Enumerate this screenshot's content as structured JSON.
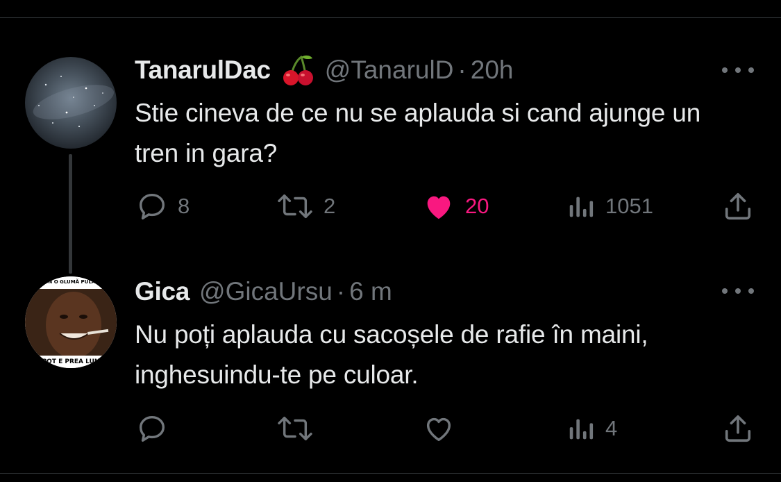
{
  "tweets": [
    {
      "display_name": "TanarulDac",
      "name_emoji": "cherries",
      "handle": "@TanarulD",
      "separator": "·",
      "time": "20h",
      "text": "Stie cineva de ce nu se aplauda si cand ajunge un tren in gara?",
      "avatar": "starry-night-sky-avatar",
      "actions": {
        "reply": {
          "icon": "reply-icon",
          "count": "8"
        },
        "retweet": {
          "icon": "retweet-icon",
          "count": "2"
        },
        "like": {
          "icon": "heart-filled-icon",
          "count": "20",
          "liked": true,
          "color": "#f91880"
        },
        "views": {
          "icon": "views-icon",
          "count": "1051"
        },
        "share": {
          "icon": "share-icon"
        }
      }
    },
    {
      "display_name": "Gica",
      "handle": "@GicaUrsu",
      "separator": "·",
      "time": "6 m",
      "text": "Nu poți aplauda cu sacoșele de rafie în maini, inghesuindu-te pe culoar.",
      "avatar": "meme-man-avatar",
      "avatar_caption_top": "VI SPUN O GLUMĂ PULA MEA?",
      "avatar_caption_bottom": "POT E PREA LUN",
      "actions": {
        "reply": {
          "icon": "reply-icon",
          "count": ""
        },
        "retweet": {
          "icon": "retweet-icon",
          "count": ""
        },
        "like": {
          "icon": "heart-outline-icon",
          "count": "",
          "liked": false
        },
        "views": {
          "icon": "views-icon",
          "count": "4"
        },
        "share": {
          "icon": "share-icon"
        }
      }
    }
  ],
  "colors": {
    "background": "#000000",
    "text_primary": "#e7e9ea",
    "text_secondary": "#71767b",
    "like": "#f91880",
    "divider": "#2f3336"
  }
}
